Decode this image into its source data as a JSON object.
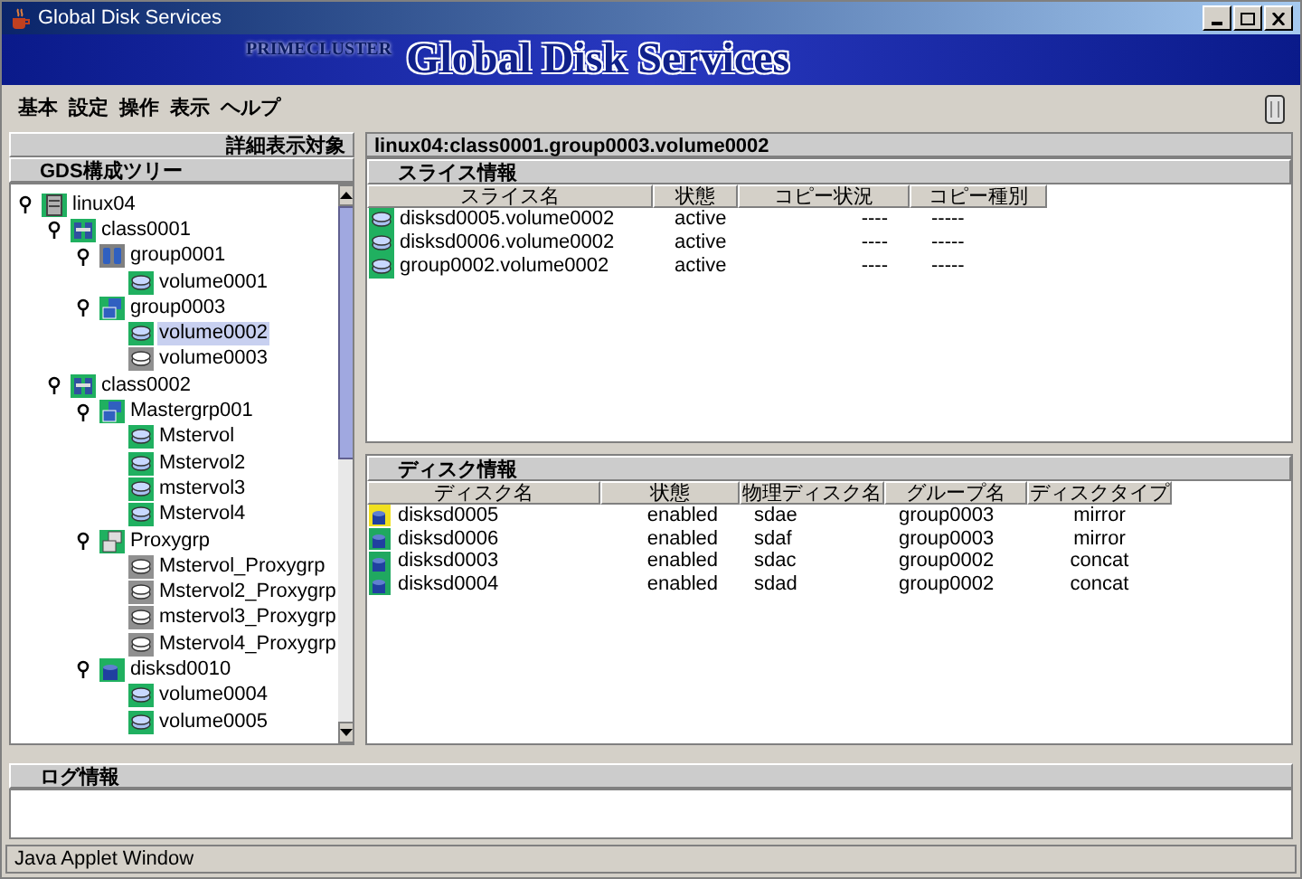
{
  "window": {
    "title": "Global Disk Services"
  },
  "banner": {
    "brand": "PRIMECLUSTER",
    "product": "Global Disk Services"
  },
  "menu": [
    "基本",
    "設定",
    "操作",
    "表示",
    "ヘルプ"
  ],
  "left_panel": {
    "caption": "詳細表示対象",
    "title": "GDS構成ツリー",
    "tree": [
      {
        "label": "linux04",
        "kind": "host",
        "selected": false,
        "children": [
          {
            "label": "class0001",
            "kind": "class",
            "selected": false,
            "children": [
              {
                "label": "group0001",
                "kind": "mirror-group",
                "selected": false,
                "children": [
                  {
                    "label": "volume0001",
                    "kind": "volume",
                    "selected": false
                  }
                ]
              },
              {
                "label": "group0003",
                "kind": "group",
                "selected": false,
                "children": [
                  {
                    "label": "volume0002",
                    "kind": "volume",
                    "selected": true
                  },
                  {
                    "label": "volume0003",
                    "kind": "stopped-volume",
                    "selected": false
                  }
                ]
              }
            ]
          },
          {
            "label": "class0002",
            "kind": "class",
            "selected": false,
            "children": [
              {
                "label": "Mastergrp001",
                "kind": "group",
                "selected": false,
                "children": [
                  {
                    "label": "Mstervol",
                    "kind": "volume",
                    "selected": false
                  },
                  {
                    "label": "Mstervol2",
                    "kind": "volume",
                    "selected": false
                  },
                  {
                    "label": "mstervol3",
                    "kind": "volume",
                    "selected": false
                  },
                  {
                    "label": "Mstervol4",
                    "kind": "volume",
                    "selected": false
                  }
                ]
              },
              {
                "label": "Proxygrp",
                "kind": "proxy-group",
                "selected": false,
                "children": [
                  {
                    "label": "Mstervol_Proxygrp",
                    "kind": "stopped-volume",
                    "selected": false
                  },
                  {
                    "label": "Mstervol2_Proxygrp",
                    "kind": "stopped-volume",
                    "selected": false
                  },
                  {
                    "label": "mstervol3_Proxygrp",
                    "kind": "stopped-volume",
                    "selected": false
                  },
                  {
                    "label": "Mstervol4_Proxygrp",
                    "kind": "stopped-volume",
                    "selected": false
                  }
                ]
              },
              {
                "label": "disksd0010",
                "kind": "disk",
                "selected": false,
                "children": [
                  {
                    "label": "volume0004",
                    "kind": "volume",
                    "selected": false
                  },
                  {
                    "label": "volume0005",
                    "kind": "volume",
                    "selected": false
                  }
                ]
              }
            ]
          }
        ]
      }
    ]
  },
  "detail": {
    "path": "linux04:class0001.group0003.volume0002",
    "slice_table": {
      "title": "スライス情報",
      "columns": [
        "スライス名",
        "状態",
        "コピー状況",
        "コピー種別"
      ],
      "rows": [
        [
          "disksd0005.volume0002",
          "active",
          "----",
          "-----"
        ],
        [
          "disksd0006.volume0002",
          "active",
          "----",
          "-----"
        ],
        [
          "group0002.volume0002",
          "active",
          "----",
          "-----"
        ]
      ]
    },
    "disk_table": {
      "title": "ディスク情報",
      "columns": [
        "ディスク名",
        "状態",
        "物理ディスク名",
        "グループ名",
        "ディスクタイプ"
      ],
      "rows": [
        {
          "color": "#f0e020",
          "cells": [
            "disksd0005",
            "enabled",
            "sdae",
            "group0003",
            "mirror"
          ]
        },
        {
          "color": "#20a860",
          "cells": [
            "disksd0006",
            "enabled",
            "sdaf",
            "group0003",
            "mirror"
          ]
        },
        {
          "color": "#20a860",
          "cells": [
            "disksd0003",
            "enabled",
            "sdac",
            "group0002",
            "concat"
          ]
        },
        {
          "color": "#20a860",
          "cells": [
            "disksd0004",
            "enabled",
            "sdad",
            "group0002",
            "concat"
          ]
        }
      ]
    }
  },
  "log_panel": {
    "title": "ログ情報"
  },
  "status_bar": "Java Applet Window"
}
